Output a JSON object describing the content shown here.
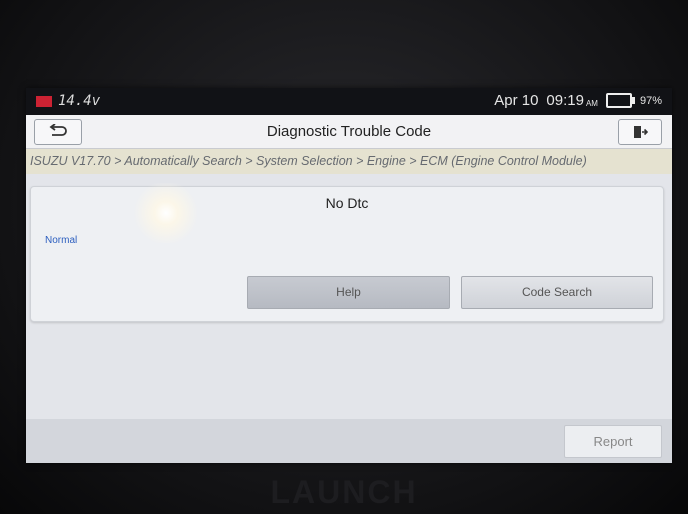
{
  "status_bar": {
    "voltage": "14.4v",
    "date": "Apr 10",
    "time": "09:19",
    "ampm": "AM",
    "battery_percent": "97%"
  },
  "header": {
    "title": "Diagnostic Trouble Code"
  },
  "breadcrumb": "ISUZU V17.70 > Automatically Search > System Selection > Engine > ECM (Engine Control Module)",
  "result": {
    "message": "No Dtc",
    "status": "Normal"
  },
  "buttons": {
    "help": "Help",
    "code_search": "Code Search",
    "report": "Report"
  },
  "device": {
    "brand": "LAUNCH"
  },
  "icons": {
    "back": "back-arrow-icon",
    "exit": "exit-icon",
    "battery": "battery-icon",
    "vehicle_battery": "vehicle-battery-icon"
  }
}
